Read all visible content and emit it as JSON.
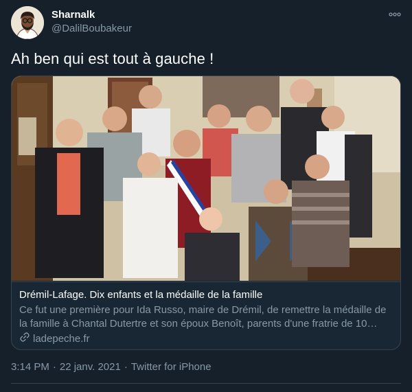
{
  "author": {
    "name": "Sharnalk",
    "handle": "@DalilBoubakeur"
  },
  "tweet": {
    "text": "Ah ben qui est tout à gauche !"
  },
  "card": {
    "title": "Drémil-Lafage. Dix enfants et la médaille de la famille",
    "description": "Ce fut une première pour Ida Russo, maire de Drémil, de remettre la médaille de la famille à Chantal Dutertre et son époux Benoît, parents d'une fratrie de 10 enfant...",
    "domain": "ladepeche.fr",
    "link_icon": "link-icon"
  },
  "meta": {
    "time": "3:14 PM",
    "separator": "·",
    "date": "22 janv. 2021",
    "source": "Twitter for iPhone"
  },
  "colors": {
    "background": "#15202b",
    "secondary_text": "#8899a6",
    "border": "#38444d"
  }
}
